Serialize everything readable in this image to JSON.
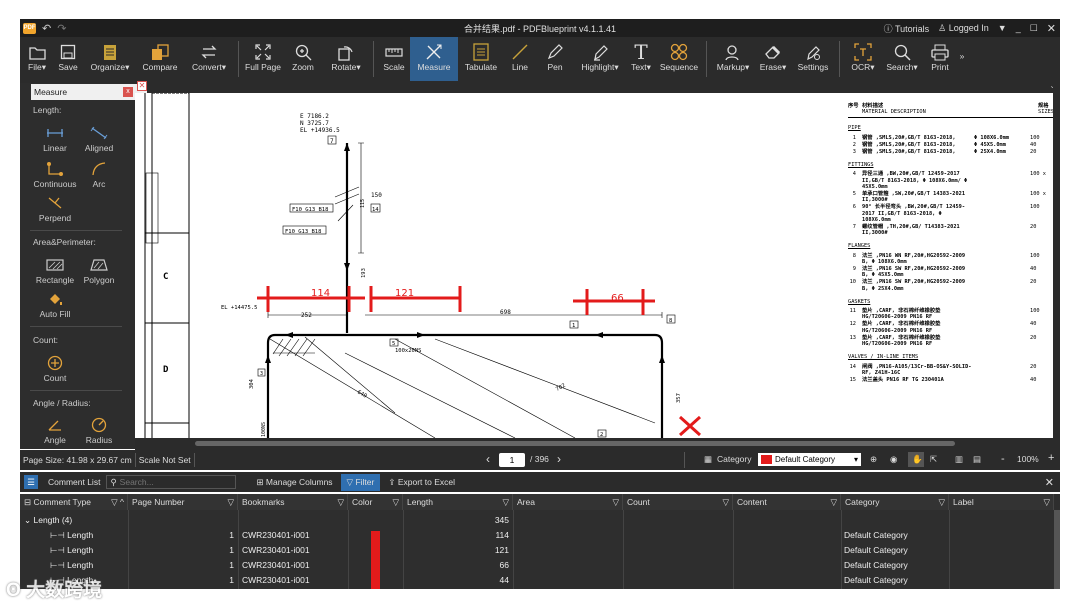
{
  "titlebar": {
    "title": "合并结果.pdf - PDFBlueprint v4.1.1.41",
    "tutorials": "Tutorials",
    "logged_in": "Logged In",
    "logo": "PDF"
  },
  "toolbar": {
    "items": [
      {
        "label": "File"
      },
      {
        "label": "Save"
      },
      {
        "label": "Organize"
      },
      {
        "label": "Compare"
      },
      {
        "label": "Convert"
      },
      {
        "label": "Full Page"
      },
      {
        "label": "Zoom"
      },
      {
        "label": "Rotate"
      },
      {
        "label": "Scale"
      },
      {
        "label": "Measure"
      },
      {
        "label": "Tabulate"
      },
      {
        "label": "Line"
      },
      {
        "label": "Pen"
      },
      {
        "label": "Highlight"
      },
      {
        "label": "Text"
      },
      {
        "label": "Sequence"
      },
      {
        "label": "Markup"
      },
      {
        "label": "Erase"
      },
      {
        "label": "Settings"
      },
      {
        "label": "OCR"
      },
      {
        "label": "Search"
      },
      {
        "label": "Print"
      }
    ]
  },
  "sidebar": {
    "title": "Measure",
    "close": "x",
    "length_label": "Length:",
    "length_tools": {
      "linear": "Linear",
      "aligned": "Aligned",
      "continuous": "Continuous",
      "arc": "Arc",
      "perpend": "Perpend"
    },
    "area_label": "Area&Perimeter:",
    "area_tools": {
      "rectangle": "Rectangle",
      "polygon": "Polygon",
      "autofill": "Auto Fill"
    },
    "count_label": "Count:",
    "count_tool": "Count",
    "angle_label": "Angle / Radius:",
    "angle_tools": {
      "angle": "Angle",
      "radius": "Radius"
    }
  },
  "drawing": {
    "coords": [
      "E 7186.2",
      "N 3725.7",
      "EL +14936.5"
    ],
    "tags": [
      "7",
      "7",
      "F10 G13 B18",
      "F10 G13 B18",
      "14",
      "150",
      "115",
      "EL +14475.5",
      "252",
      "698",
      "5",
      "100x20NS",
      "1",
      "8",
      "640",
      "702",
      "357",
      "304",
      "193",
      "100NS",
      "2",
      "3"
    ],
    "meas": [
      "114",
      "121",
      "66"
    ],
    "grid_letters": [
      "C",
      "D"
    ]
  },
  "table_text": {
    "header": [
      "序号",
      "材料描述",
      "MATERIAL DESCRIPTION",
      "规格",
      "SIZES"
    ],
    "sections": [
      "PIPE",
      "FITTINGS",
      "FLANGES",
      "GASKETS",
      "VALVES / IN-LINE ITEMS"
    ],
    "rows": [
      {
        "n": "1",
        "d": "钢管 ,SMLS,20#,GB/T 8163-2018,",
        "s": "Φ 108X6.0mm",
        "q": "100"
      },
      {
        "n": "2",
        "d": "钢管 ,SMLS,20#,GB/T 8163-2018,",
        "s": "Φ 45X5.0mm",
        "q": "40"
      },
      {
        "n": "3",
        "d": "钢管 ,SMLS,20#,GB/T 8163-2018,",
        "s": "Φ 25X4.0mm",
        "q": "20"
      },
      {
        "n": "4",
        "d": "异径三通 ,BW,20#,GB/T 12459-2017 II,GB/T 8163-2018, Φ 108X6.0mm/ Φ 45X5.0mm",
        "s": "",
        "q": "100 x"
      },
      {
        "n": "5",
        "d": "单承口管箍 ,SW,20#,GB/T 14383-2021 II,3000#",
        "s": "",
        "q": "100 x"
      },
      {
        "n": "6",
        "d": "90° 长半径弯头 ,BW,20#,GB/T 12459-2017 II,GB/T 8163-2018, Φ 108X6.0mm",
        "s": "",
        "q": "100"
      },
      {
        "n": "7",
        "d": "螺纹管帽 ,TH,20#,GB/ T14383-2021 II,3000#",
        "s": "",
        "q": "20"
      },
      {
        "n": "8",
        "d": "法兰 ,PN16 WN RF,20#,HG20592-2009 B, Φ 108X6.0mm",
        "s": "",
        "q": "100"
      },
      {
        "n": "9",
        "d": "法兰 ,PN16 SW RF,20#,HG20592-2009 B, Φ 45X5.0mm",
        "s": "",
        "q": "40"
      },
      {
        "n": "10",
        "d": "法兰 ,PN16 SW RF,20#,HG20592-2009 B, Φ 25X4.0mm",
        "s": "",
        "q": "20"
      },
      {
        "n": "11",
        "d": "垫片 ,CARF, 非石棉纤维橡胶垫 HG/T20606-2009 PN16 RF",
        "s": "",
        "q": "100"
      },
      {
        "n": "12",
        "d": "垫片 ,CARF, 非石棉纤维橡胶垫 HG/T20606-2009 PN16 RF",
        "s": "",
        "q": "40"
      },
      {
        "n": "13",
        "d": "垫片 ,CARF, 非石棉纤维橡胶垫 HG/T20606-2009 PN16 RF",
        "s": "",
        "q": "20"
      },
      {
        "n": "14",
        "d": "闸阀 ,PN16-A105/13Cr-BB-OS&Y-SOLID-RF, Z41H-16C",
        "s": "",
        "q": "20"
      },
      {
        "n": "15",
        "d": "法兰盖头 PN16 RF TG 230401A",
        "s": "",
        "q": "40"
      }
    ]
  },
  "status": {
    "page_size": "Page Size: 41.98 x 29.67 cm",
    "scale": "Scale Not Set",
    "page": "1",
    "total": "/ 396",
    "category_label": "Category",
    "category_value": "Default Category",
    "zoom": "100%",
    "minus": "-",
    "plus": "+"
  },
  "comments": {
    "title": "Comment List",
    "search_placeholder": "Search...",
    "manage": "Manage Columns",
    "filter": "Filter",
    "export": "Export to Excel"
  },
  "columns": [
    "Comment Type",
    "Page Number",
    "Bookmarks",
    "Color",
    "Length",
    "Area",
    "Count",
    "Content",
    "Category",
    "Label"
  ],
  "group": {
    "label": "Length (4)",
    "total": "345"
  },
  "rows": [
    {
      "type": "Length",
      "page": "1",
      "bookmark": "CWR230401-i001",
      "length": "114",
      "category": "Default Category"
    },
    {
      "type": "Length",
      "page": "1",
      "bookmark": "CWR230401-i001",
      "length": "121",
      "category": "Default Category"
    },
    {
      "type": "Length",
      "page": "1",
      "bookmark": "CWR230401-i001",
      "length": "66",
      "category": "Default Category"
    },
    {
      "type": "Length",
      "page": "1",
      "bookmark": "CWR230401-i001",
      "length": "44",
      "category": "Default Category"
    }
  ],
  "colors": {
    "accent": "#2f5f8f",
    "measure": "#e31b1b"
  },
  "watermark": "大数跨境"
}
